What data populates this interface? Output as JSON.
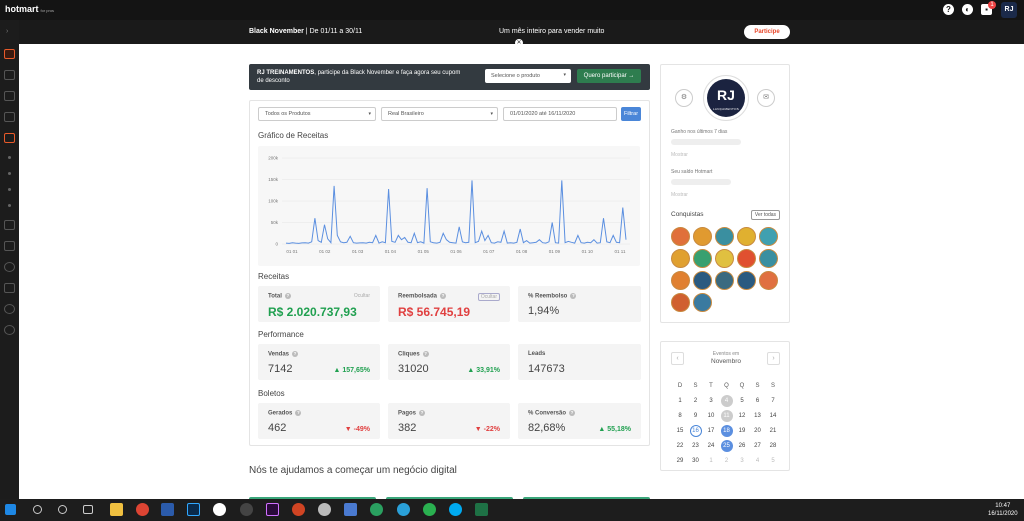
{
  "app": {
    "brand": "hotmart",
    "brand_sub": "for pros"
  },
  "topbar": {
    "notifications_count": "1",
    "user_initials": "RJ"
  },
  "banner": {
    "event_name": "Black November",
    "event_dates": " | De 01/11 a 30/11",
    "tagline": "Um mês inteiro para vender muito",
    "cta": "Participe"
  },
  "promo": {
    "brand": "RJ TREINAMENTOS",
    "text": ", participe da Black November e faça agora seu cupom de desconto",
    "select_placeholder": "Selecione o produto",
    "button": "Quero participar →"
  },
  "filters": {
    "product": "Todos os Produtos",
    "currency": "Real Brasileiro",
    "date_range": "01/01/2020 até 16/11/2020",
    "button": "Filtrar"
  },
  "revenue_chart_title": "Gráfico de Receitas",
  "chart_data": {
    "type": "line",
    "yticks": [
      "200k",
      "150k",
      "100k",
      "50k",
      "0"
    ],
    "ylim": [
      0,
      200000
    ],
    "xticks": [
      "01 01",
      "01 02",
      "01 03",
      "01 04",
      "01 05",
      "01 06",
      "01 07",
      "01 08",
      "01 09",
      "01 10",
      "01 11"
    ],
    "color": "#5b8fe0",
    "series": [
      {
        "values": [
          2000,
          1500,
          3000,
          2000,
          1500,
          2500,
          3000,
          2000,
          5000,
          60000,
          8000,
          4000,
          45000,
          12000,
          3000,
          135000,
          20000,
          5000,
          3000,
          4000,
          18000,
          3000,
          2000,
          2500,
          3000,
          2000,
          4000,
          3000,
          20000,
          2000,
          5000,
          3000,
          128000,
          6000,
          4000,
          20000,
          10000,
          15000,
          4000,
          3000,
          25000,
          3000,
          5000,
          2000,
          130000,
          5000,
          3000,
          2000,
          4000,
          25000,
          10000,
          4000,
          3000,
          2000,
          40000,
          5000,
          3000,
          4000,
          148000,
          3000,
          6000,
          30000,
          8000,
          20000,
          3000,
          2000,
          5000,
          4000,
          30000,
          2000,
          3000,
          2000,
          4000,
          35000,
          3000,
          8000,
          2000,
          3000,
          4000,
          10000,
          3000,
          2000,
          5000,
          50000,
          3000,
          2000,
          148000,
          3000,
          6000,
          4000,
          2000,
          20000,
          3000,
          2000,
          4000,
          3000,
          10000,
          2000,
          3000,
          60000,
          5000,
          3000,
          20000,
          4000,
          3000,
          85000,
          10000
        ]
      }
    ]
  },
  "receitas": {
    "title": "Receitas",
    "total": {
      "label": "Total",
      "value": "R$ 2.020.737,93",
      "hide": "Ocultar"
    },
    "reembolsada": {
      "label": "Reembolsada",
      "value": "R$ 56.745,19",
      "hide": "Ocultar"
    },
    "pct_reembolso": {
      "label": "% Reembolso",
      "value": "1,94%"
    }
  },
  "performance": {
    "title": "Performance",
    "vendas": {
      "label": "Vendas",
      "value": "7142",
      "change": "157,65%"
    },
    "cliques": {
      "label": "Cliques",
      "value": "31020",
      "change": "33,91%"
    },
    "leads": {
      "label": "Leads",
      "value": "147673"
    }
  },
  "boletos": {
    "title": "Boletos",
    "gerados": {
      "label": "Gerados",
      "value": "462",
      "change": "-49%"
    },
    "pagos": {
      "label": "Pagos",
      "value": "382",
      "change": "-22%"
    },
    "conversao": {
      "label": "% Conversão",
      "value": "82,68%",
      "change": "55,18%"
    }
  },
  "help_title": "Nós te ajudamos a começar um negócio digital",
  "profile": {
    "avatar_text": "RJ",
    "avatar_sub": "LANÇAMENTOS",
    "last7_label": "Ganho nos últimos 7 dias",
    "hidden1": "Mostrar",
    "balance_label": "Seu saldo Hotmart",
    "hidden2": "Mostrar",
    "achievements_title": "Conquistas",
    "see_all": "Ver todas",
    "badge_colors": [
      "#e0703a",
      "#e09a30",
      "#3a8fa0",
      "#e0b030",
      "#40a0b0",
      "#e0a030",
      "#38a070",
      "#e0c040",
      "#e05030",
      "#3a8fa0",
      "#e08030",
      "#2a5a80",
      "#3a6a80",
      "#2a5a80",
      "#e07040",
      "#d06030",
      "#3a7aa0"
    ]
  },
  "calendar": {
    "header": "Eventos em",
    "month": "Novembro",
    "dow": [
      "D",
      "S",
      "T",
      "Q",
      "Q",
      "S",
      "S"
    ],
    "weeks": [
      [
        "1",
        "2",
        "3",
        "4",
        "5",
        "6",
        "7"
      ],
      [
        "8",
        "9",
        "10",
        "11",
        "12",
        "13",
        "14"
      ],
      [
        "15",
        "16",
        "17",
        "18",
        "19",
        "20",
        "21"
      ],
      [
        "22",
        "23",
        "24",
        "25",
        "26",
        "27",
        "28"
      ],
      [
        "29",
        "30",
        "1",
        "2",
        "3",
        "4",
        "5"
      ]
    ]
  },
  "taskbar": {
    "time": "10:47",
    "date": "16/11/2020"
  }
}
